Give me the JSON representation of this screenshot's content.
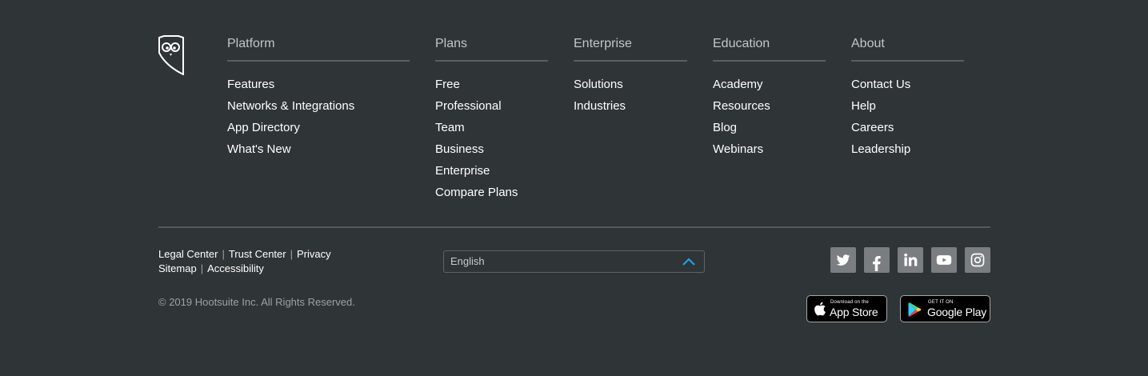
{
  "columns": [
    {
      "title": "Platform",
      "items": [
        "Features",
        "Networks & Integrations",
        "App Directory",
        "What's New"
      ]
    },
    {
      "title": "Plans",
      "items": [
        "Free",
        "Professional",
        "Team",
        "Business",
        "Enterprise",
        "Compare Plans"
      ]
    },
    {
      "title": "Enterprise",
      "items": [
        "Solutions",
        "Industries"
      ]
    },
    {
      "title": "Education",
      "items": [
        "Academy",
        "Resources",
        "Blog",
        "Webinars"
      ]
    },
    {
      "title": "About",
      "items": [
        "Contact Us",
        "Help",
        "Careers",
        "Leadership"
      ]
    }
  ],
  "legal": {
    "row1": [
      "Legal Center",
      "Trust Center",
      "Privacy"
    ],
    "row2": [
      "Sitemap",
      "Accessibility"
    ],
    "separator": "|"
  },
  "copyright": "© 2019 Hootsuite Inc. All Rights Reserved.",
  "language": {
    "selected": "English"
  },
  "social": [
    "twitter-icon",
    "facebook-icon",
    "linkedin-icon",
    "youtube-icon",
    "instagram-icon"
  ],
  "stores": {
    "apple": {
      "small": "Download on the",
      "big": "App Store"
    },
    "google": {
      "small": "GET IT ON",
      "big": "Google Play"
    }
  },
  "colors": {
    "background": "#2f3436",
    "accent": "#1ea0e6",
    "social_bg": "#7a7e80"
  }
}
